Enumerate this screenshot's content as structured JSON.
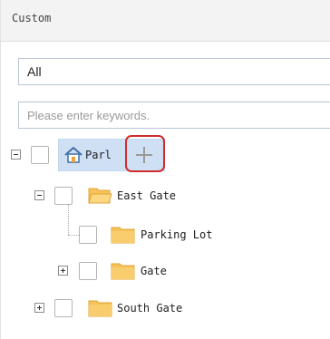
{
  "panel": {
    "title": "Custom"
  },
  "filter": {
    "selected": "All"
  },
  "search": {
    "placeholder": "Please enter keywords.",
    "value": ""
  },
  "tree": {
    "root": {
      "label": "Parl",
      "icon": "home-icon",
      "expander": "collapse",
      "action_icon": "add-icon"
    },
    "nodes": [
      {
        "label": "East Gate",
        "icon": "folder-open-icon",
        "expander": "collapse"
      },
      {
        "label": "Parking Lot",
        "icon": "folder-icon",
        "expander": "none"
      },
      {
        "label": "Gate",
        "icon": "folder-icon",
        "expander": "expand"
      },
      {
        "label": "South Gate",
        "icon": "folder-icon",
        "expander": "expand"
      }
    ]
  },
  "colors": {
    "selection": "#cfe0f5",
    "focus_ring": "#d12c2c",
    "folder": "#f6c25a",
    "input_border": "#b9c6d6"
  }
}
